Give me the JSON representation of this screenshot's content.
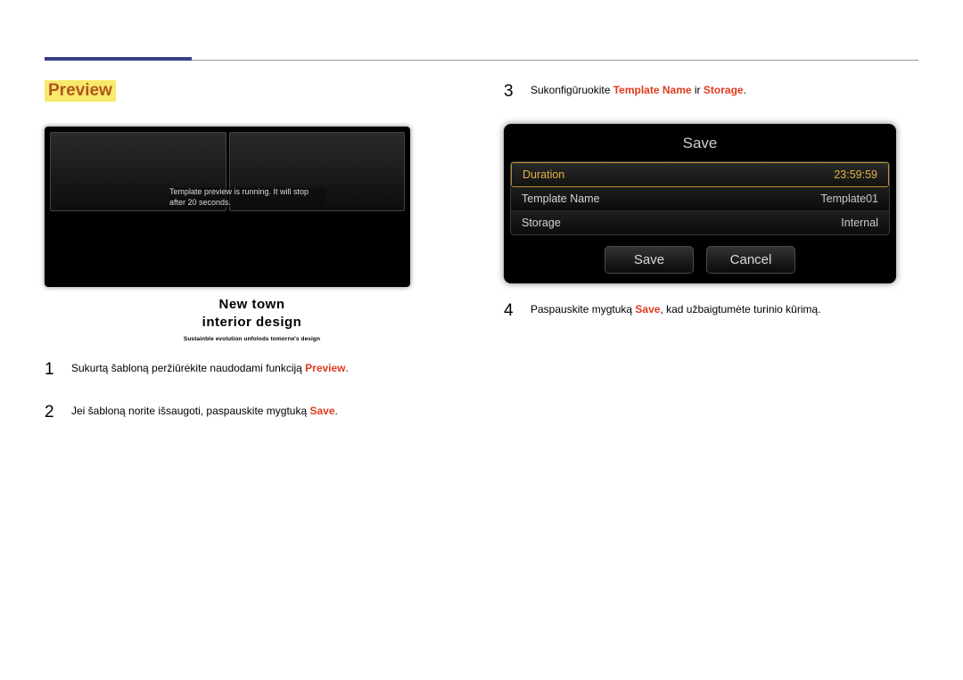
{
  "left": {
    "section_title": "Preview",
    "preview_running1": "Template preview is running. It will stop",
    "preview_running2": "after 20 seconds.",
    "caption1": "New town",
    "caption2": "interior design",
    "caption_sub": "Sustainble evolution unfolods tomorrw's design",
    "step1_pre": "Sukurtą šabloną peržiūrėkite naudodami funkciją ",
    "step1_em": "Preview",
    "step1_post": ".",
    "step2_pre": "Jei šabloną norite išsaugoti, paspauskite mygtuką ",
    "step2_em": "Save",
    "step2_post": "."
  },
  "right": {
    "step3_pre": "Sukonfigūruokite ",
    "step3_em1": "Template Name",
    "step3_mid": " ir ",
    "step3_em2": "Storage",
    "step3_post": ".",
    "dialog": {
      "title": "Save",
      "rows": [
        {
          "label": "Duration",
          "value": "23:59:59",
          "selected": true
        },
        {
          "label": "Template Name",
          "value": "Template01",
          "selected": false
        },
        {
          "label": "Storage",
          "value": "Internal",
          "selected": false
        }
      ],
      "btn_save": "Save",
      "btn_cancel": "Cancel"
    },
    "step4_pre": "Paspauskite mygtuką ",
    "step4_em": "Save",
    "step4_post": ", kad užbaigtumėte turinio kūrimą."
  }
}
